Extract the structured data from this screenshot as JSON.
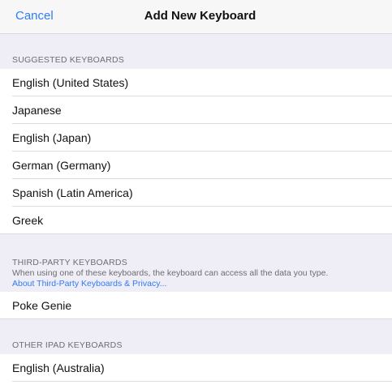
{
  "nav": {
    "cancel_label": "Cancel",
    "title": "Add New Keyboard"
  },
  "suggested": {
    "header": "SUGGESTED KEYBOARDS",
    "items": [
      {
        "label": "English (United States)"
      },
      {
        "label": "Japanese"
      },
      {
        "label": "English (Japan)"
      },
      {
        "label": "German (Germany)"
      },
      {
        "label": "Spanish (Latin America)"
      },
      {
        "label": "Greek"
      }
    ]
  },
  "third_party": {
    "header": "THIRD-PARTY KEYBOARDS",
    "note": "When using one of these keyboards, the keyboard can access all the data you type.",
    "link": "About Third-Party Keyboards & Privacy...",
    "items": [
      {
        "label": "Poke Genie"
      }
    ]
  },
  "other_ipad": {
    "header": "OTHER IPAD KEYBOARDS",
    "items": [
      {
        "label": "English (Australia)"
      }
    ]
  },
  "colors": {
    "accent": "#2f7cf6",
    "group_background": "#efedf5",
    "nav_background": "#f7f7f8"
  }
}
